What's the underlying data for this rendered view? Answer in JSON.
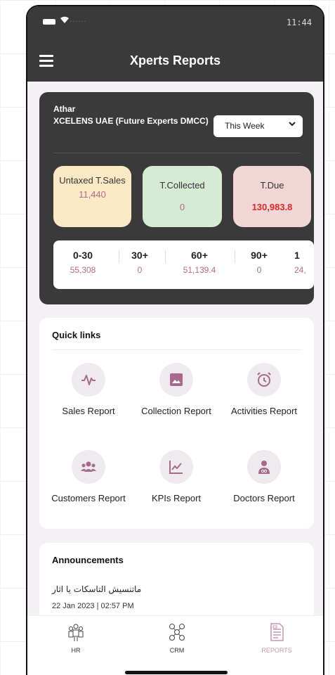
{
  "status_bar": {
    "time": "11:44"
  },
  "header": {
    "title": "Xperts Reports"
  },
  "summary": {
    "user": "Athar",
    "company": "XCELENS UAE (Future Experts DMCC)",
    "period": "This Week",
    "tiles": {
      "sales_label": "Untaxed T.Sales",
      "sales_value": "11,440",
      "collected_label": "T.Collected",
      "collected_value": "0",
      "due_label": "T.Due",
      "due_value": "130,983.8"
    },
    "aging": [
      {
        "label": "0-30",
        "value": "55,308"
      },
      {
        "label": "30+",
        "value": "0"
      },
      {
        "label": "60+",
        "value": "51,139.4"
      },
      {
        "label": "90+",
        "value": "0"
      },
      {
        "label": "1",
        "value": "24,"
      }
    ],
    "colors": {
      "sales_tile": "#fbe9c6",
      "collected_tile": "#d5ebd3",
      "due_tile": "#f2d6d6",
      "due_value": "#d42a2a"
    }
  },
  "quick_links": {
    "title": "Quick links",
    "items": [
      {
        "label": "Sales Report",
        "icon": "pulse-icon"
      },
      {
        "label": "Collection Report",
        "icon": "gallery-icon"
      },
      {
        "label": "Activities Report",
        "icon": "alarm-clock-icon"
      },
      {
        "label": "Customers Report",
        "icon": "group-icon"
      },
      {
        "label": "KPIs Report",
        "icon": "line-chart-icon"
      },
      {
        "label": "Doctors Report",
        "icon": "doctor-icon"
      }
    ]
  },
  "announcements": {
    "title": "Announcements",
    "items": [
      {
        "text": "ماتنسيش التاسكات يا اثار",
        "date": "22 Jan 2023 | 02:57 PM"
      }
    ]
  },
  "tabbar": {
    "items": [
      {
        "label": "HR",
        "icon": "hr-people-icon"
      },
      {
        "label": "CRM",
        "icon": "network-icon"
      },
      {
        "label": "REPORTS",
        "icon": "report-document-icon",
        "active": true
      }
    ],
    "accent": "#c496ad"
  }
}
